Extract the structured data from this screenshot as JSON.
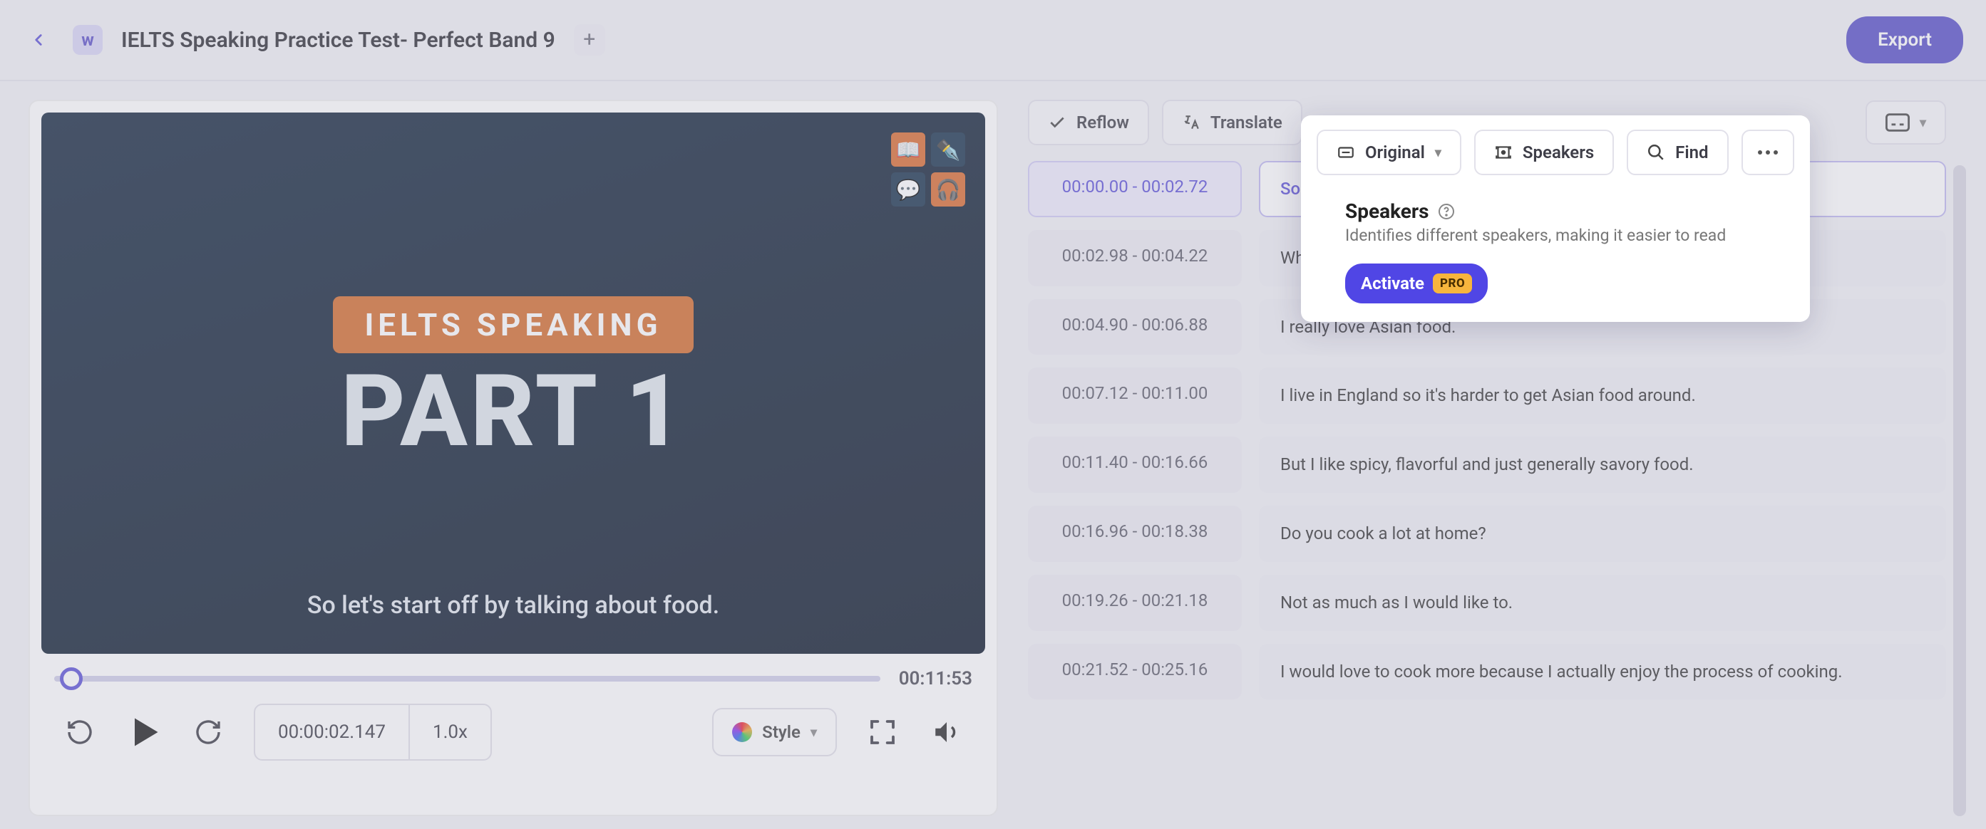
{
  "header": {
    "back_icon": "chevron-left",
    "logo_glyph": "w",
    "title": "IELTS Speaking Practice Test- Perfect Band 9",
    "export_label": "Export"
  },
  "video": {
    "kicker": "IELTS SPEAKING",
    "part": "PART 1",
    "caption": "So let's start off by talking about food.",
    "duration": "00:11:53",
    "current_time": "00:00:02.147",
    "speed": "1.0x",
    "style_label": "Style"
  },
  "toolbar": {
    "reflow": "Reflow",
    "translate": "Translate",
    "original": "Original",
    "speakers": "Speakers",
    "find": "Find"
  },
  "popover": {
    "title": "Speakers",
    "subtitle": "Identifies different speakers, making it easier to read",
    "activate": "Activate",
    "pro": "PRO"
  },
  "transcript": [
    {
      "start": "00:00.00",
      "end": "00:02.72",
      "text": "So let",
      "active": true
    },
    {
      "start": "00:02.98",
      "end": "00:04.22",
      "text": "What'"
    },
    {
      "start": "00:04.90",
      "end": "00:06.88",
      "text": "I really love Asian food."
    },
    {
      "start": "00:07.12",
      "end": "00:11.00",
      "text": "I live in England so it's harder to get Asian food around."
    },
    {
      "start": "00:11.40",
      "end": "00:16.66",
      "text": "But I like spicy, flavorful and just generally savory food."
    },
    {
      "start": "00:16.96",
      "end": "00:18.38",
      "text": "Do you cook a lot at home?"
    },
    {
      "start": "00:19.26",
      "end": "00:21.18",
      "text": "Not as much as I would like to."
    },
    {
      "start": "00:21.52",
      "end": "00:25.16",
      "text": "I would love to cook more because I actually enjoy the process of cooking."
    }
  ]
}
